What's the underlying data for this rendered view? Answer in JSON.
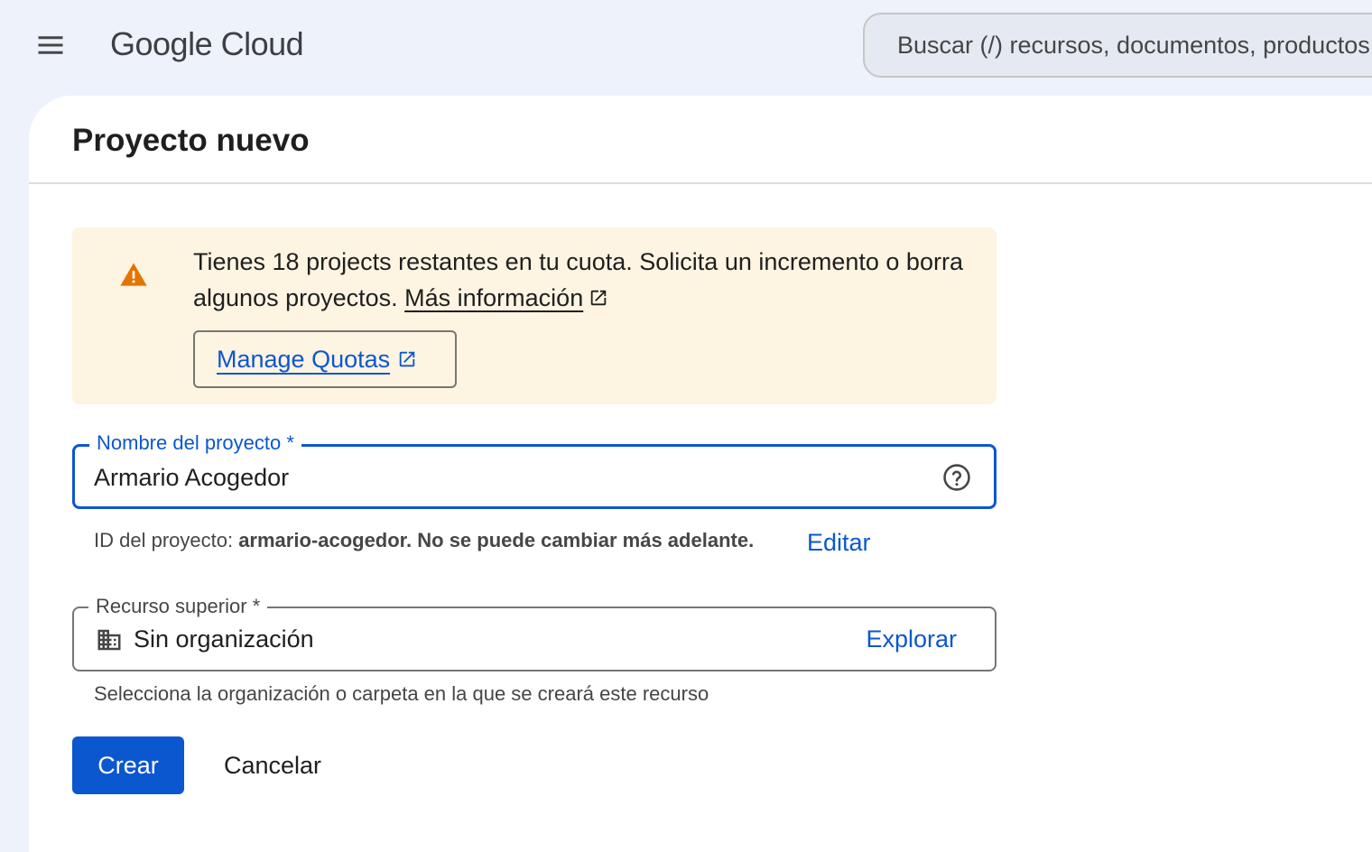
{
  "header": {
    "menu_icon": "hamburger-menu-icon",
    "logo_text": "Google Cloud",
    "search_placeholder": "Buscar (/) recursos, documentos, productos y más"
  },
  "page": {
    "title": "Proyecto nuevo"
  },
  "quota_banner": {
    "icon": "warning-icon",
    "icon_color": "#e37400",
    "background": "#fef4e2",
    "text": "Tienes 18 projects restantes en tu cuota. Solicita un incremento o borra algunos proyectos. ",
    "link_label": "Más información",
    "manage_button_label": "Manage Quotas"
  },
  "project_name": {
    "label": "Nombre del proyecto *",
    "value": "Armario Acogedor",
    "help_icon": "help-circle-icon"
  },
  "project_id": {
    "prefix": "ID del proyecto: ",
    "value": "armario-acogedor.",
    "note": " No se puede cambiar más adelante.",
    "edit_label": "Editar"
  },
  "parent_resource": {
    "label": "Recurso superior *",
    "icon": "organization-building-icon",
    "value": "Sin organización",
    "browse_label": "Explorar",
    "hint": "Selecciona la organización o carpeta en la que se creará este recurso"
  },
  "actions": {
    "create_label": "Crear",
    "cancel_label": "Cancelar"
  },
  "colors": {
    "accent": "#0b57d0",
    "background": "#eef2fb"
  }
}
